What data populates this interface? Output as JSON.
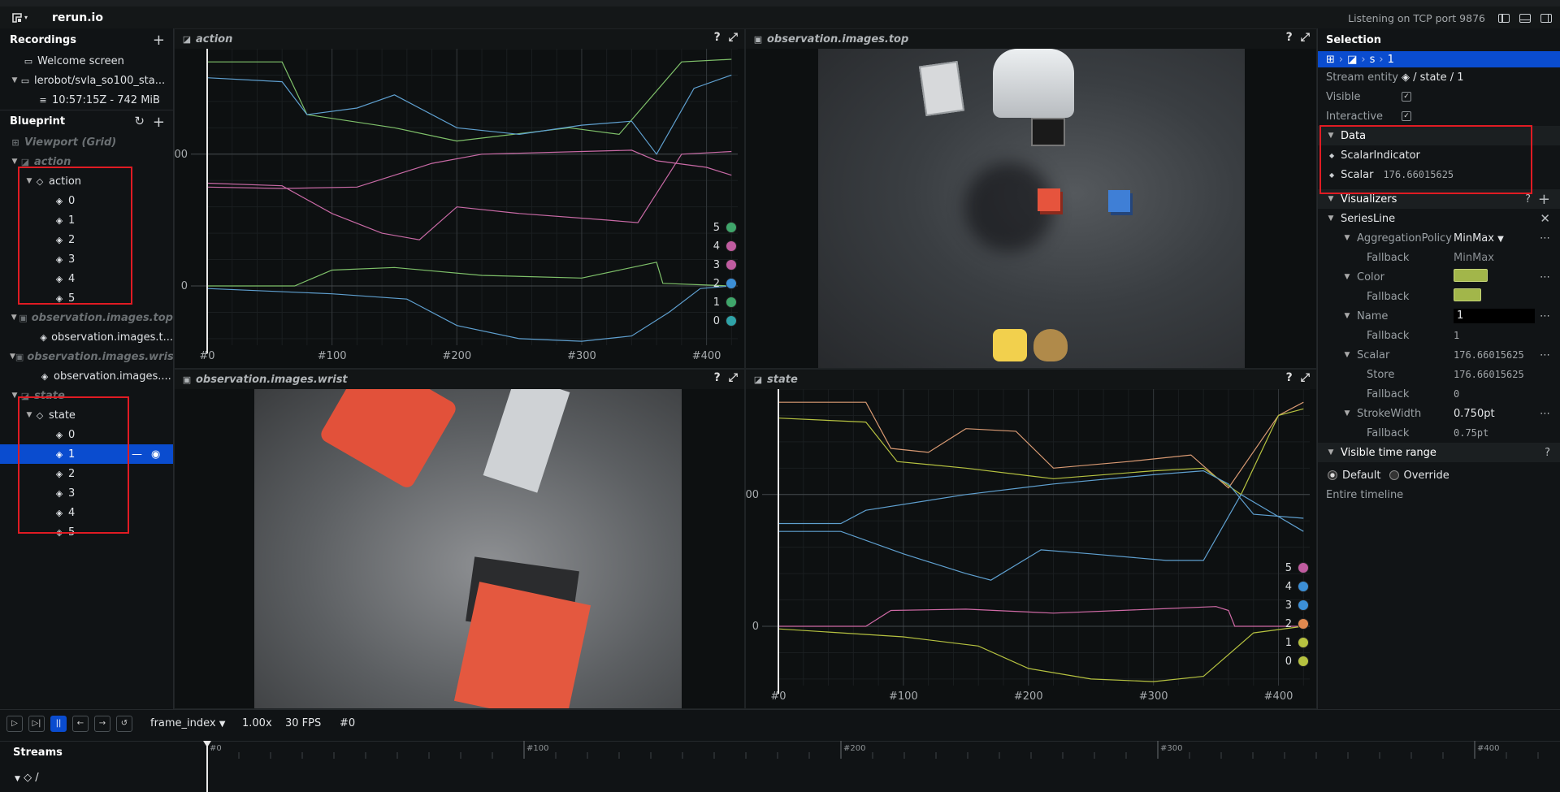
{
  "app": {
    "title": "rerun.io",
    "listening": "Listening on TCP port 9876"
  },
  "recordings": {
    "header": "Recordings",
    "welcome": "Welcome screen",
    "recording": "lerobot/svla_so100_sta...",
    "entry": "10:57:15Z - 742 MiB"
  },
  "blueprint": {
    "header": "Blueprint",
    "viewport": "Viewport (Grid)",
    "action_view": "action",
    "action_entity": "action",
    "action_children": [
      "0",
      "1",
      "2",
      "3",
      "4",
      "5"
    ],
    "top_view": "observation.images.top",
    "top_entity": "observation.images.t...",
    "wrist_view": "observation.images.wrist",
    "wrist_entity": "observation.images....",
    "state_view": "state",
    "state_entity": "state",
    "state_children": [
      "0",
      "1",
      "2",
      "3",
      "4",
      "5"
    ]
  },
  "views": {
    "action": {
      "title": "action"
    },
    "top": {
      "title": "observation.images.top"
    },
    "wrist": {
      "title": "observation.images.wrist"
    },
    "state": {
      "title": "state"
    }
  },
  "chart_data": [
    {
      "type": "line",
      "title": "action",
      "xticks": [
        "#0",
        "#100",
        "#200",
        "#300",
        "#400"
      ],
      "yticks": [
        "0",
        "100"
      ],
      "xlim": [
        0,
        425
      ],
      "legend": [
        "5",
        "4",
        "3",
        "2",
        "1",
        "0"
      ],
      "colors": {
        "5": "#3fa66b",
        "4": "#c05ca0",
        "3": "#c05ca0",
        "2": "#3c8fd6",
        "1": "#3fa66b",
        "0": "#2fa3a8"
      },
      "series": [
        {
          "name": "5",
          "color": "#7fc16a",
          "points": [
            [
              0,
              170
            ],
            [
              60,
              170
            ],
            [
              80,
              130
            ],
            [
              150,
              120
            ],
            [
              200,
              110
            ],
            [
              290,
              120
            ],
            [
              330,
              115
            ],
            [
              380,
              170
            ],
            [
              420,
              172
            ]
          ]
        },
        {
          "name": "4",
          "color": "#5fa0d0",
          "points": [
            [
              0,
              158
            ],
            [
              60,
              155
            ],
            [
              80,
              130
            ],
            [
              120,
              135
            ],
            [
              150,
              145
            ],
            [
              200,
              120
            ],
            [
              250,
              115
            ],
            [
              300,
              122
            ],
            [
              340,
              125
            ],
            [
              360,
              100
            ],
            [
              390,
              150
            ],
            [
              420,
              160
            ]
          ]
        },
        {
          "name": "3",
          "color": "#c96aa6",
          "points": [
            [
              0,
              75
            ],
            [
              60,
              74
            ],
            [
              120,
              75
            ],
            [
              180,
              93
            ],
            [
              220,
              100
            ],
            [
              300,
              102
            ],
            [
              340,
              103
            ],
            [
              360,
              95
            ],
            [
              400,
              90
            ],
            [
              420,
              84
            ]
          ]
        },
        {
          "name": "2",
          "color": "#c96aa6",
          "points": [
            [
              0,
              78
            ],
            [
              60,
              76
            ],
            [
              100,
              55
            ],
            [
              140,
              40
            ],
            [
              170,
              35
            ],
            [
              200,
              60
            ],
            [
              250,
              55
            ],
            [
              320,
              50
            ],
            [
              345,
              48
            ],
            [
              380,
              100
            ],
            [
              420,
              102
            ]
          ]
        },
        {
          "name": "1",
          "color": "#7fc16a",
          "points": [
            [
              0,
              0
            ],
            [
              70,
              0
            ],
            [
              100,
              12
            ],
            [
              150,
              14
            ],
            [
              220,
              8
            ],
            [
              300,
              6
            ],
            [
              340,
              14
            ],
            [
              360,
              18
            ],
            [
              365,
              2
            ],
            [
              420,
              0
            ]
          ]
        },
        {
          "name": "0",
          "color": "#5fa0d0",
          "points": [
            [
              0,
              -2
            ],
            [
              100,
              -6
            ],
            [
              160,
              -10
            ],
            [
              200,
              -30
            ],
            [
              250,
              -40
            ],
            [
              300,
              -42
            ],
            [
              340,
              -38
            ],
            [
              370,
              -20
            ],
            [
              395,
              -2
            ],
            [
              420,
              0
            ]
          ]
        }
      ]
    },
    {
      "type": "line",
      "title": "state",
      "xticks": [
        "#0",
        "#100",
        "#200",
        "#300",
        "#400"
      ],
      "yticks": [
        "0",
        "100"
      ],
      "xlim": [
        0,
        425
      ],
      "legend": [
        "5",
        "4",
        "3",
        "2",
        "1",
        "0"
      ],
      "colors": {
        "5": "#c05ca0",
        "4": "#3c8fd6",
        "3": "#3c8fd6",
        "2": "#e0894f",
        "1": "#b6c240",
        "0": "#b6c240"
      },
      "series": [
        {
          "name": "5",
          "color": "#d99a73",
          "points": [
            [
              0,
              170
            ],
            [
              70,
              170
            ],
            [
              90,
              135
            ],
            [
              120,
              132
            ],
            [
              150,
              150
            ],
            [
              190,
              148
            ],
            [
              220,
              120
            ],
            [
              280,
              125
            ],
            [
              330,
              130
            ],
            [
              360,
              105
            ],
            [
              400,
              160
            ],
            [
              420,
              170
            ]
          ]
        },
        {
          "name": "4",
          "color": "#b6c240",
          "points": [
            [
              0,
              158
            ],
            [
              70,
              155
            ],
            [
              95,
              125
            ],
            [
              150,
              120
            ],
            [
              220,
              112
            ],
            [
              300,
              118
            ],
            [
              340,
              120
            ],
            [
              370,
              100
            ],
            [
              400,
              160
            ],
            [
              420,
              165
            ]
          ]
        },
        {
          "name": "3",
          "color": "#5fa0d0",
          "points": [
            [
              0,
              78
            ],
            [
              50,
              78
            ],
            [
              70,
              88
            ],
            [
              150,
              100
            ],
            [
              220,
              108
            ],
            [
              300,
              115
            ],
            [
              340,
              118
            ],
            [
              360,
              108
            ],
            [
              380,
              85
            ],
            [
              420,
              82
            ]
          ]
        },
        {
          "name": "2",
          "color": "#5fa0d0",
          "points": [
            [
              0,
              72
            ],
            [
              50,
              72
            ],
            [
              100,
              55
            ],
            [
              150,
              40
            ],
            [
              170,
              35
            ],
            [
              210,
              58
            ],
            [
              250,
              55
            ],
            [
              310,
              50
            ],
            [
              340,
              50
            ],
            [
              370,
              100
            ],
            [
              420,
              72
            ]
          ]
        },
        {
          "name": "1",
          "color": "#d06aa6",
          "points": [
            [
              0,
              0
            ],
            [
              70,
              0
            ],
            [
              90,
              12
            ],
            [
              150,
              13
            ],
            [
              220,
              10
            ],
            [
              300,
              13
            ],
            [
              350,
              15
            ],
            [
              360,
              12
            ],
            [
              365,
              0
            ],
            [
              420,
              0
            ]
          ]
        },
        {
          "name": "0",
          "color": "#b6c240",
          "points": [
            [
              0,
              -2
            ],
            [
              100,
              -8
            ],
            [
              160,
              -15
            ],
            [
              200,
              -32
            ],
            [
              250,
              -40
            ],
            [
              300,
              -42
            ],
            [
              340,
              -38
            ],
            [
              380,
              -5
            ],
            [
              420,
              0
            ]
          ]
        }
      ]
    }
  ],
  "selection": {
    "header": "Selection",
    "breadcrumb": "s",
    "breadcrumb_last": "1",
    "stream_entity_label": "Stream entity",
    "stream_entity_value": "/ state / 1",
    "visible_label": "Visible",
    "interactive_label": "Interactive",
    "data_header": "Data",
    "scalar_indicator": "ScalarIndicator",
    "scalar_label": "Scalar",
    "scalar_value": "176.66015625",
    "visualizers_header": "Visualizers",
    "series_line": "SeriesLine",
    "aggregation_label": "AggregationPolicy",
    "aggregation_value": "MinMax",
    "fallback_label": "Fallback",
    "aggregation_fallback": "MinMax",
    "color_label": "Color",
    "color_value": "#a2b64a",
    "name_label": "Name",
    "name_value": "1",
    "name_fallback": "1",
    "scalar_row_label": "Scalar",
    "scalar_row_value": "176.66015625",
    "store_label": "Store",
    "store_value": "176.66015625",
    "scalar_fallback": "0",
    "stroke_label": "StrokeWidth",
    "stroke_value": "0.750pt",
    "stroke_fallback": "0.75pt",
    "vtr_header": "Visible time range",
    "default_label": "Default",
    "override_label": "Override",
    "entire_timeline": "Entire timeline"
  },
  "timeline": {
    "timeline_name": "frame_index",
    "speed": "1.00x",
    "fps": "30 FPS",
    "current": "#0",
    "streams_label": "Streams",
    "root_entity": "/",
    "ticks": [
      "#0",
      "#100",
      "#200",
      "#300",
      "#400"
    ]
  }
}
